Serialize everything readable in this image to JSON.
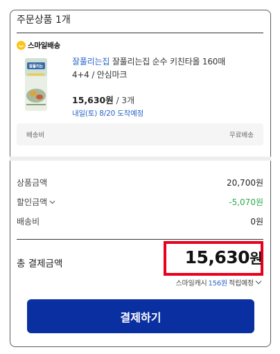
{
  "order": {
    "title": "주문상품 1개",
    "delivery_badge": "스마일배송",
    "product": {
      "brand": "잘풀리는집",
      "name": "잘풀리는집 순수 키친타올 160매 4+4 / 안심마크",
      "price": "15,630원",
      "qty": "/ 3개",
      "arrival": "내일(토) 8/20 도착예정",
      "thumb_label": "잘풀리는"
    },
    "shipping": {
      "label": "배송비",
      "value": "무료배송"
    }
  },
  "summary": {
    "rows": [
      {
        "label": "상품금액",
        "value": "20,700원"
      },
      {
        "label": "할인금액",
        "value": "-5,070원"
      },
      {
        "label": "배송비",
        "value": "0원"
      }
    ],
    "total_label": "총 결제금액",
    "total_amount": "15,630",
    "total_unit": "원",
    "cash_prefix": "스마일캐시",
    "cash_value": "156원",
    "cash_suffix": "적립예정"
  },
  "pay_button_label": "결제하기",
  "colors": {
    "accent_blue": "#2a63c9",
    "button": "#0a2fa0",
    "discount": "#2fa84f",
    "highlight": "#e8001c",
    "smile_badge": "#ffc21a"
  }
}
